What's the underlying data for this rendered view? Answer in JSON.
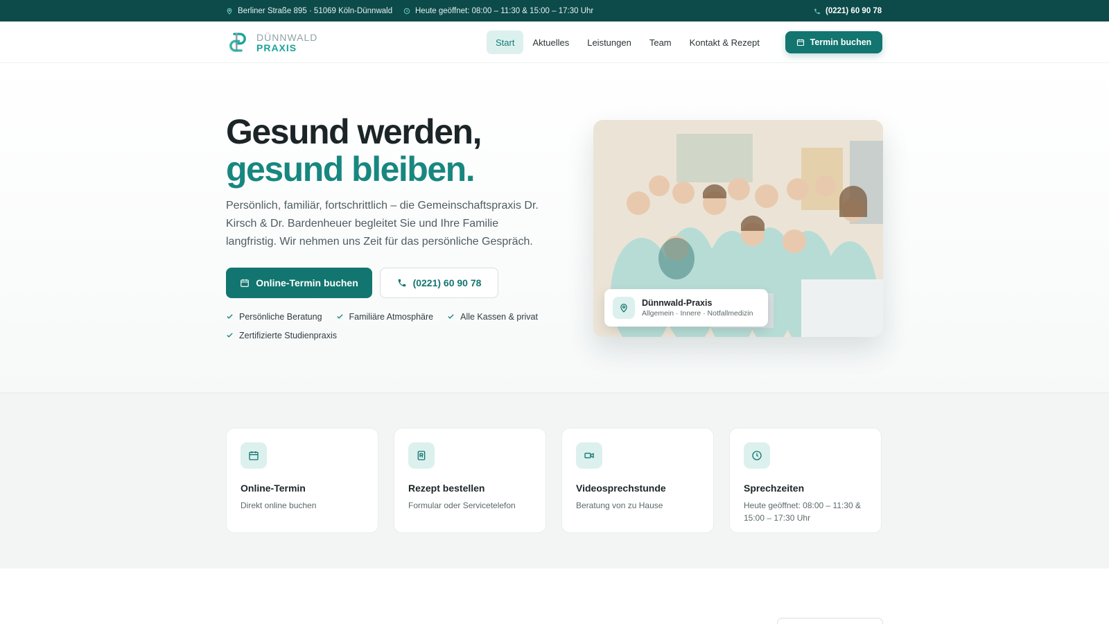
{
  "topbar": {
    "address": "Berliner Straße 895 · 51069 Köln-Dünnwald",
    "hours": "Heute geöffnet: 08:00 – 11:30 & 15:00 – 17:30 Uhr",
    "phone": "(0221) 60 90 78",
    "icons": [
      "map-pin-icon",
      "clock-icon",
      "phone-icon"
    ]
  },
  "header": {
    "logo": {
      "line1": "DÜNNWALD",
      "line2": "PRAXIS"
    },
    "nav": [
      {
        "label": "Start",
        "active": true
      },
      {
        "label": "Aktuelles",
        "active": false
      },
      {
        "label": "Leistungen",
        "active": false
      },
      {
        "label": "Team",
        "active": false
      },
      {
        "label": "Kontakt & Rezept",
        "active": false
      }
    ],
    "book_button": "Termin buchen"
  },
  "hero": {
    "headline_line1": "Gesund werden,",
    "headline_line2": "gesund bleiben.",
    "lead": "Persönlich, familiär, fortschrittlich – die Gemeinschaftspraxis Dr. Kirsch & Dr. Bardenheuer begleitet Sie und Ihre Familie langfristig. Wir nehmen uns Zeit für das persönliche Gespräch.",
    "cta_primary": "Online-Termin buchen",
    "cta_secondary": "(0221) 60 90 78",
    "features": [
      "Persönliche Beratung",
      "Familiäre Atmosphäre",
      "Alle Kassen & privat",
      "Zertifizierte Studienpraxis"
    ],
    "photo_card": {
      "title": "Dünnwald-Praxis",
      "subtitle": "Allgemein · Innere · Notfallmedizin"
    }
  },
  "quick_links": [
    {
      "icon": "calendar-icon",
      "title": "Online-Termin",
      "subtitle": "Direkt online buchen"
    },
    {
      "icon": "prescription-icon",
      "title": "Rezept bestellen",
      "subtitle": "Formular oder Servicetelefon"
    },
    {
      "icon": "video-icon",
      "title": "Videosprechstunde",
      "subtitle": "Beratung von zu Hause"
    },
    {
      "icon": "clock-icon",
      "title": "Sprechzeiten",
      "subtitle": "Heute geöffnet: 08:00 – 11:30 & 15:00 – 17:30 Uhr"
    }
  ],
  "colors": {
    "brand": "#13756f",
    "brand_dark": "#0d4a4a",
    "accent_text": "#17877f",
    "accent_bg": "#dcf1ee"
  }
}
